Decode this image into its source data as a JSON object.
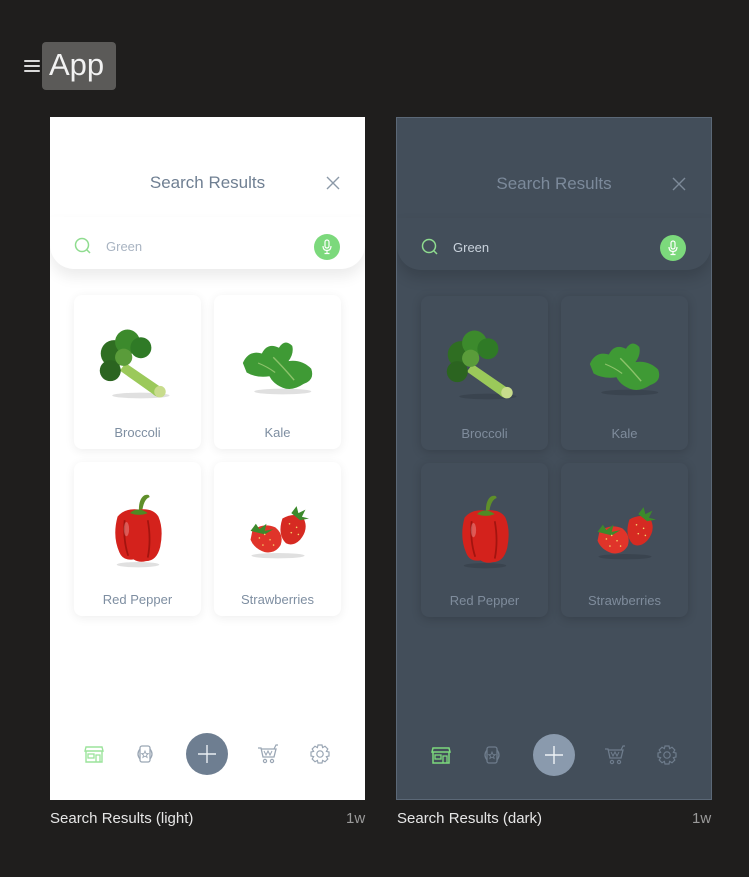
{
  "app": {
    "title": "App",
    "menu_icon": "hamburger-icon"
  },
  "colors": {
    "accent_green": "#7cd97c",
    "text_muted": "#6f7f92",
    "light_bg": "#ffffff",
    "dark_bg": "#434e5a",
    "canvas_bg": "#1f1e1d"
  },
  "frames": [
    {
      "theme": "light",
      "caption": "Search Results (light)",
      "timestamp": "1w",
      "screen": {
        "title": "Search Results",
        "close_icon": "close-icon",
        "search": {
          "value": "Green",
          "search_icon": "search-icon",
          "mic_icon": "microphone-icon"
        },
        "results": [
          {
            "label": "Broccoli",
            "image": "broccoli"
          },
          {
            "label": "Kale",
            "image": "kale"
          },
          {
            "label": "Red Pepper",
            "image": "red-pepper"
          },
          {
            "label": "Strawberries",
            "image": "strawberries"
          }
        ],
        "nav": [
          "store-icon",
          "product-badge-icon",
          "plus-icon",
          "cart-icon",
          "gear-icon"
        ]
      }
    },
    {
      "theme": "dark",
      "caption": "Search Results (dark)",
      "timestamp": "1w",
      "screen": {
        "title": "Search Results",
        "close_icon": "close-icon",
        "search": {
          "value": "Green",
          "search_icon": "search-icon",
          "mic_icon": "microphone-icon"
        },
        "results": [
          {
            "label": "Broccoli",
            "image": "broccoli"
          },
          {
            "label": "Kale",
            "image": "kale"
          },
          {
            "label": "Red Pepper",
            "image": "red-pepper"
          },
          {
            "label": "Strawberries",
            "image": "strawberries"
          }
        ],
        "nav": [
          "store-icon",
          "product-badge-icon",
          "plus-icon",
          "cart-icon",
          "gear-icon"
        ]
      }
    }
  ]
}
